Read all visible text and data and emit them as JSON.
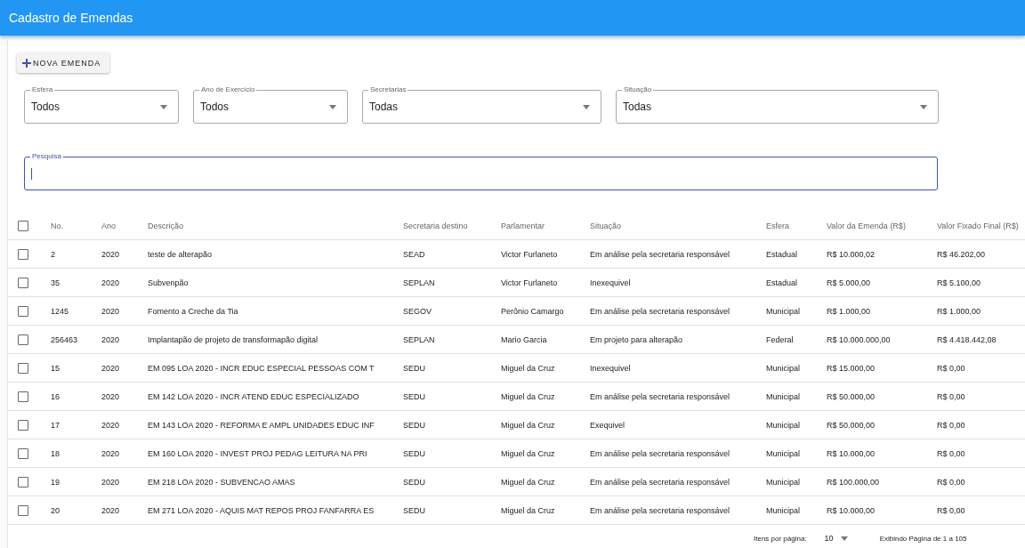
{
  "app_bar": {
    "title": "Cadastro de Emendas"
  },
  "new_button": {
    "label": "NOVA EMENDA"
  },
  "filters": [
    {
      "label": "Esfera",
      "value": "Todos"
    },
    {
      "label": "Ano de Exercício",
      "value": "Todos"
    },
    {
      "label": "Secretarias",
      "value": "Todas"
    },
    {
      "label": "Situação",
      "value": "Todas"
    }
  ],
  "search": {
    "label": "Pesquisa",
    "focused": true
  },
  "table": {
    "select_all": false,
    "columns": [
      "No.",
      "Ano",
      "Descrição",
      "Secretaria destino",
      "Parlamentar",
      "Situação",
      "Esfera",
      "Valor da Emenda (R$)",
      "Valor Fixado Final (R$)"
    ],
    "rows": [
      {
        "selected": false,
        "cells": [
          "2",
          "2020",
          "teste de alterapão",
          "SEAD",
          "Victor Furlaneto",
          "Em análise pela secretaria responsável",
          "Estadual",
          "R$ 10.000,02",
          "R$ 46.202,00"
        ]
      },
      {
        "selected": false,
        "cells": [
          "35",
          "2020",
          "Subvenpão",
          "SEPLAN",
          "Victor Furlaneto",
          "Inexequivel",
          "Estadual",
          "R$ 5.000,00",
          "R$ 5.100,00"
        ]
      },
      {
        "selected": false,
        "cells": [
          "1245",
          "2020",
          "Fomento a Creche da Tia",
          "SEGOV",
          "Perônio Camargo",
          "Em análise pela secretaria responsável",
          "Municipal",
          "R$ 1.000,00",
          "R$ 1.000,00"
        ]
      },
      {
        "selected": false,
        "cells": [
          "256463",
          "2020",
          "Implantapão de projeto de transformapão digital",
          "SEPLAN",
          "Mario Garcia",
          "Em projeto para alterapão",
          "Federal",
          "R$ 10.000.000,00",
          "R$ 4.418.442,08"
        ]
      },
      {
        "selected": false,
        "cells": [
          "15",
          "2020",
          "EM 095 LOA 2020 - INCR EDUC ESPECIAL PESSOAS COM T",
          "SEDU",
          "Miguel da Cruz",
          "Inexequivel",
          "Municipal",
          "R$ 15.000,00",
          "R$ 0,00"
        ]
      },
      {
        "selected": false,
        "cells": [
          "16",
          "2020",
          "EM 142 LOA 2020 - INCR ATEND EDUC ESPECIALIZADO",
          "SEDU",
          "Miguel da Cruz",
          "Em análise pela secretaria responsável",
          "Municipal",
          "R$ 50.000,00",
          "R$ 0,00"
        ]
      },
      {
        "selected": false,
        "cells": [
          "17",
          "2020",
          "EM 143 LOA 2020 - REFORMA E AMPL UNIDADES EDUC INF",
          "SEDU",
          "Miguel da Cruz",
          "Exequivel",
          "Municipal",
          "R$ 50.000,00",
          "R$ 0,00"
        ]
      },
      {
        "selected": false,
        "cells": [
          "18",
          "2020",
          "EM 160 LOA 2020 - INVEST PROJ PEDAG LEITURA NA PRI",
          "SEDU",
          "Miguel da Cruz",
          "Em análise pela secretaria responsável",
          "Municipal",
          "R$ 10.000,00",
          "R$ 0,00"
        ]
      },
      {
        "selected": false,
        "cells": [
          "19",
          "2020",
          "EM 218 LOA 2020 - SUBVENCAO AMAS",
          "SEDU",
          "Miguel da Cruz",
          "Em análise pela secretaria responsável",
          "Municipal",
          "R$ 100.000,00",
          "R$ 0,00"
        ]
      },
      {
        "selected": false,
        "cells": [
          "20",
          "2020",
          "EM 271 LOA 2020 - AQUIS MAT REPOS PROJ FANFARRA ES",
          "SEDU",
          "Miguel da Cruz",
          "Em análise pela secretaria responsável",
          "Municipal",
          "R$ 10.000,00",
          "R$ 0,00"
        ]
      }
    ]
  },
  "pagination": {
    "items_label": "Itens por página:",
    "page_size": "10",
    "range": "Exibindo Página de 1 a 105"
  }
}
